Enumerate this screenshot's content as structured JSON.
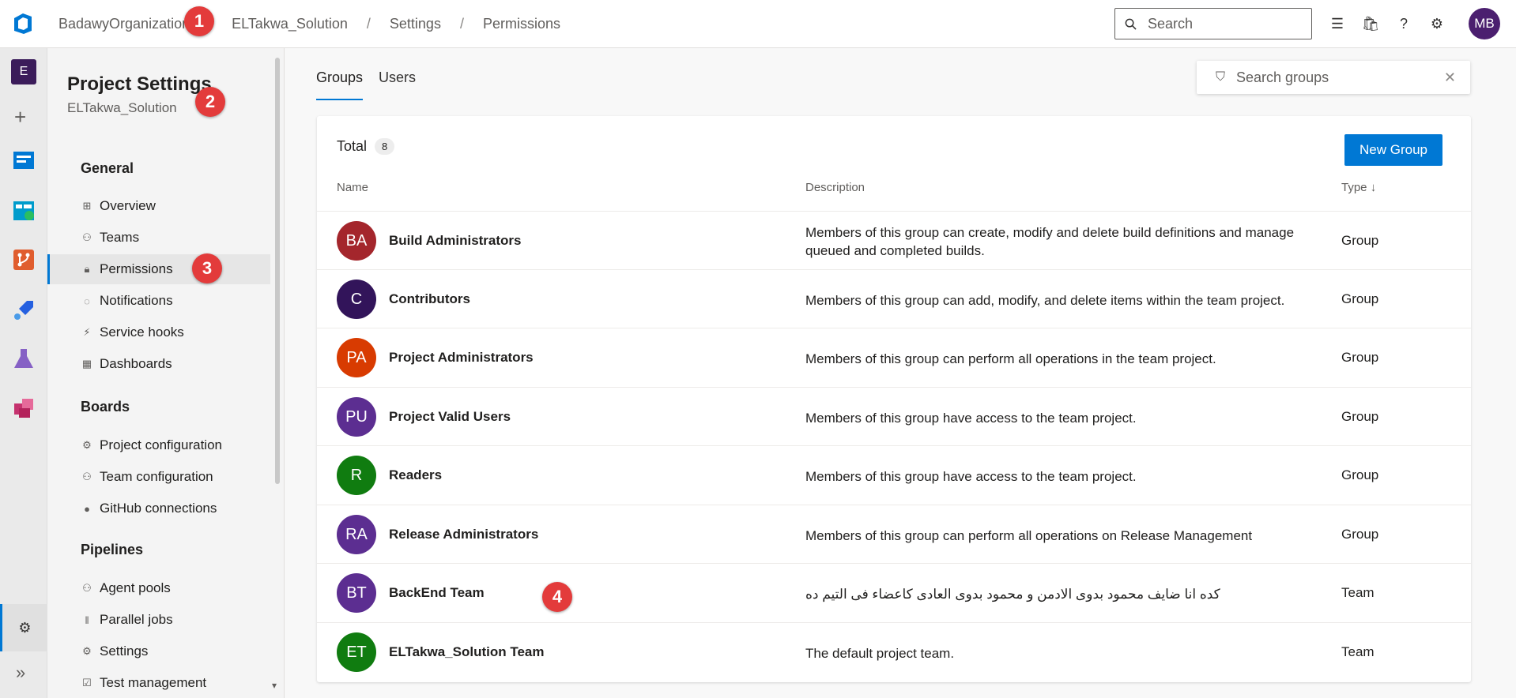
{
  "breadcrumb": [
    "BadawyOrganization",
    "ELTakwa_Solution",
    "Settings",
    "Permissions"
  ],
  "search": {
    "placeholder": "Search"
  },
  "user": {
    "initials": "MB"
  },
  "rail": {
    "project_initial": "E"
  },
  "settings_nav": {
    "title": "Project Settings",
    "project": "ELTakwa_Solution",
    "groups": [
      {
        "label": "General",
        "items": [
          "Overview",
          "Teams",
          "Permissions",
          "Notifications",
          "Service hooks",
          "Dashboards"
        ]
      },
      {
        "label": "Boards",
        "items": [
          "Project configuration",
          "Team configuration",
          "GitHub connections"
        ]
      },
      {
        "label": "Pipelines",
        "items": [
          "Agent pools",
          "Parallel jobs",
          "Settings",
          "Test management"
        ]
      }
    ]
  },
  "tabs": [
    "Groups",
    "Users"
  ],
  "search_groups": {
    "placeholder": "Search groups"
  },
  "table": {
    "total_label": "Total",
    "total_count": "8",
    "new_button": "New Group",
    "headers": {
      "name": "Name",
      "description": "Description",
      "type": "Type"
    },
    "rows": [
      {
        "initials": "BA",
        "color": "#a4262c",
        "name": "Build Administrators",
        "description": "Members of this group can create, modify and delete build definitions and manage queued and completed builds.",
        "type": "Group"
      },
      {
        "initials": "C",
        "color": "#32145a",
        "name": "Contributors",
        "description": "Members of this group can add, modify, and delete items within the team project.",
        "type": "Group"
      },
      {
        "initials": "PA",
        "color": "#d83b01",
        "name": "Project Administrators",
        "description": "Members of this group can perform all operations in the team project.",
        "type": "Group"
      },
      {
        "initials": "PU",
        "color": "#5c2e91",
        "name": "Project Valid Users",
        "description": "Members of this group have access to the team project.",
        "type": "Group"
      },
      {
        "initials": "R",
        "color": "#107c10",
        "name": "Readers",
        "description": "Members of this group have access to the team project.",
        "type": "Group"
      },
      {
        "initials": "RA",
        "color": "#5c2e91",
        "name": "Release Administrators",
        "description": "Members of this group can perform all operations on Release Management",
        "type": "Group"
      },
      {
        "initials": "BT",
        "color": "#5c2e91",
        "name": "BackEnd Team",
        "description": "كده انا ضايف محمود بدوى الادمن و محمود بدوى العادى كاعضاء فى التيم ده",
        "type": "Team"
      },
      {
        "initials": "ET",
        "color": "#107c10",
        "name": "ELTakwa_Solution Team",
        "description": "The default project team.",
        "type": "Team"
      }
    ]
  },
  "markers": [
    "1",
    "2",
    "3",
    "4"
  ]
}
